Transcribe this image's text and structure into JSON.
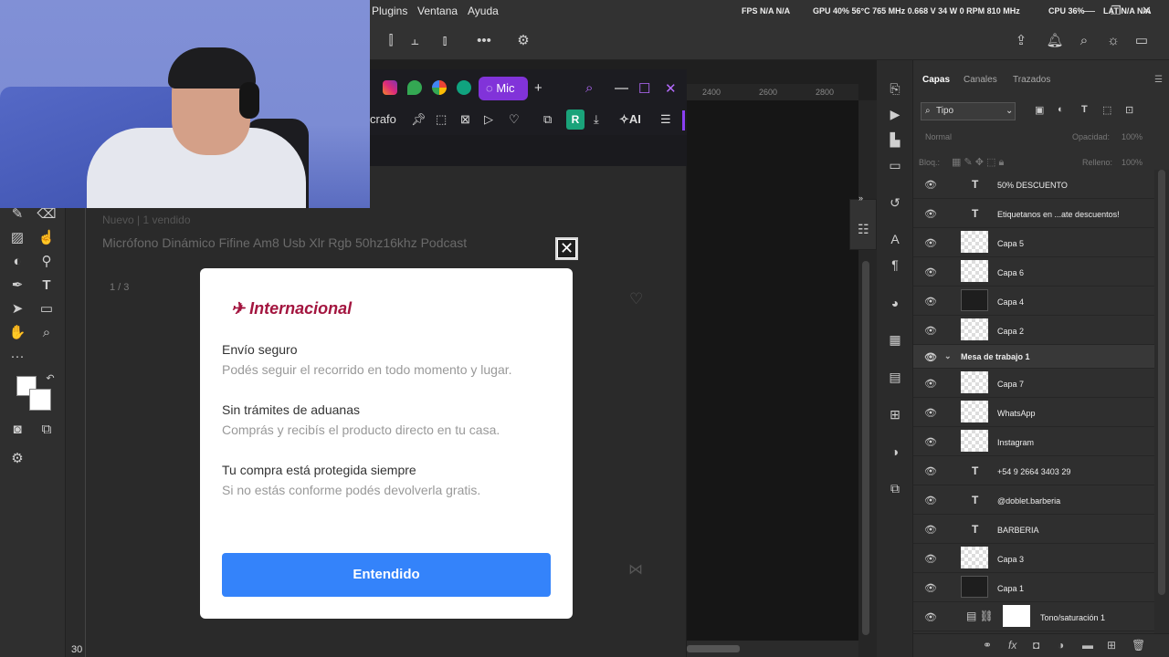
{
  "menu": {
    "items": [
      "Plugins",
      "Ventana",
      "Ayuda"
    ],
    "stats": {
      "fps": "FPS N/A N/A",
      "gpu": "GPU 40% 56°C 765 MHz 0.668 V 34 W 0 RPM 810 MHz",
      "cpu": "CPU 36%",
      "lat": "LAT N/A N/A"
    }
  },
  "browser": {
    "active_tab_label": "Mic",
    "nav_text": "crafo",
    "r_extension": "R",
    "ai_label": "AI"
  },
  "rulers": {
    "h": [
      "2400",
      "2600",
      "2800"
    ],
    "bottom_number": "30"
  },
  "product": {
    "breadcrumb": "Nuevo  |  1 vendido",
    "title": "Micrófono Dinámico Fifine Am8 Usb Xlr Rgb 50hz16khz Podcast",
    "image_counter": "1 / 3"
  },
  "modal": {
    "brand": "Internacional",
    "items": [
      {
        "title": "Envío seguro",
        "subtitle": "Podés seguir el recorrido en todo momento y lugar."
      },
      {
        "title": "Sin trámites de aduanas",
        "subtitle": "Comprás y recibís el producto directo en tu casa."
      },
      {
        "title": "Tu compra está protegida siempre",
        "subtitle": "Si no estás conforme podés devolverla gratis."
      }
    ],
    "button": "Entendido"
  },
  "layers_panel": {
    "tabs": [
      "Capas",
      "Canales",
      "Trazados"
    ],
    "filter": "Tipo",
    "blend_mode": "Normal",
    "opacity_label": "Opacidad:",
    "opacity_value": "100%",
    "lock_label": "Bloq.:",
    "fill_label": "Relleno:",
    "fill_value": "100%",
    "layers": [
      {
        "name": "50% DESCUENTO",
        "kind": "text"
      },
      {
        "name": "Etiquetanos en ...ate descuentos!",
        "kind": "text"
      },
      {
        "name": "Capa 5",
        "kind": "check"
      },
      {
        "name": "Capa 6",
        "kind": "check"
      },
      {
        "name": "Capa 4",
        "kind": "dark"
      },
      {
        "name": "Capa 2",
        "kind": "check"
      },
      {
        "name": "Mesa de trabajo 1",
        "kind": "group"
      },
      {
        "name": "Capa 7",
        "kind": "check"
      },
      {
        "name": "WhatsApp",
        "kind": "check"
      },
      {
        "name": "Instagram",
        "kind": "check"
      },
      {
        "name": "+54 9 2664 3403 29",
        "kind": "text"
      },
      {
        "name": "@doblet.barberia",
        "kind": "text"
      },
      {
        "name": "BARBERIA",
        "kind": "text"
      },
      {
        "name": "Capa 3",
        "kind": "check"
      },
      {
        "name": "Capa 1",
        "kind": "dark"
      },
      {
        "name": "Tono/saturación 1",
        "kind": "adjust"
      }
    ]
  }
}
